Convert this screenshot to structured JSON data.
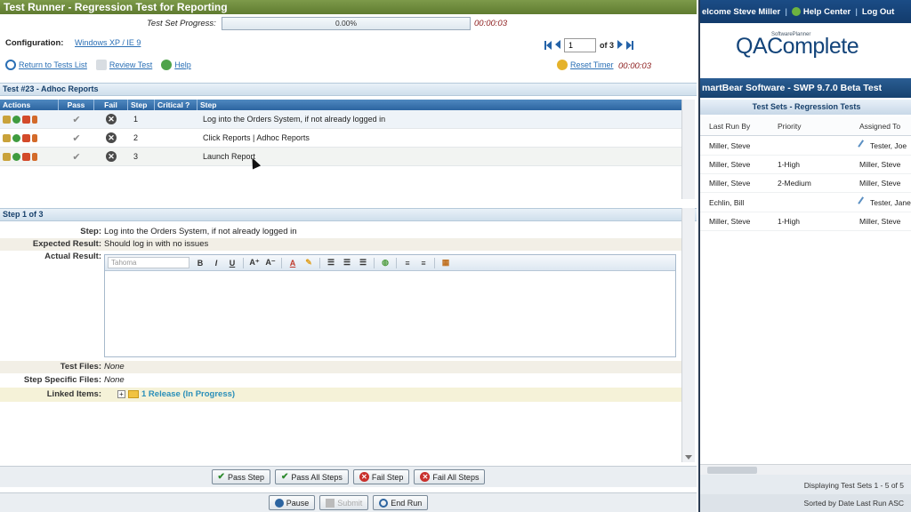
{
  "runner": {
    "title": "Test Runner - Regression Test for Reporting",
    "progress_label": "Test Set Progress:",
    "progress_value": "0.00%",
    "progress_time": "00:00:03",
    "config_label": "Configuration:",
    "config_value": "Windows XP / IE 9",
    "pager": {
      "current": "1",
      "of_label": "of 3"
    },
    "links": {
      "return": "Return to Tests List",
      "review": "Review Test",
      "help": "Help"
    },
    "reset_timer": "Reset Timer",
    "reset_time": "00:00:03",
    "test_header": "Test #23 - Adhoc Reports",
    "grid_headers": {
      "actions": "Actions",
      "pass": "Pass",
      "fail": "Fail",
      "step": "Step",
      "critical": "Critical ?",
      "step_text": "Step"
    },
    "steps": [
      {
        "no": "1",
        "text": "Log into the Orders System, if not already logged in"
      },
      {
        "no": "2",
        "text": "Click Reports | Adhoc Reports"
      },
      {
        "no": "3",
        "text": "Launch Report"
      }
    ],
    "step_header": "Step 1 of 3",
    "detail": {
      "step_label": "Step:",
      "step_value": "Log into the Orders System, if not already logged in",
      "expected_label": "Expected Result:",
      "expected_value": "Should log in with no issues",
      "actual_label": "Actual Result:",
      "font_select": "Tahoma",
      "test_files_label": "Test Files:",
      "test_files_value": "None",
      "step_files_label": "Step Specific Files:",
      "step_files_value": "None",
      "linked_label": "Linked Items:",
      "linked_value": "1 Release (In Progress)"
    },
    "buttons": {
      "pass_step": "Pass Step",
      "pass_all": "Pass All Steps",
      "fail_step": "Fail Step",
      "fail_all": "Fail All Steps",
      "pause": "Pause",
      "submit": "Submit",
      "end_run": "End Run"
    }
  },
  "qa": {
    "welcome": "elcome Steve Miller",
    "sep": "|",
    "help_center": "Help Center",
    "logout": "Log Out",
    "logo": "QAComplete",
    "logo_sub": "SoftwarePlanner",
    "banner": "martBear Software - SWP 9.7.0 Beta Test",
    "subheader": "Test Sets - Regression Tests",
    "headers": {
      "last_run_by": "Last Run By",
      "priority": "Priority",
      "assigned_to": "Assigned To"
    },
    "rows": [
      {
        "last_run_by": "Miller, Steve",
        "priority": "",
        "assigned_to": "Tester, Joe"
      },
      {
        "last_run_by": "Miller, Steve",
        "priority": "1-High",
        "assigned_to": "Miller, Steve"
      },
      {
        "last_run_by": "Miller, Steve",
        "priority": "2-Medium",
        "assigned_to": "Miller, Steve"
      },
      {
        "last_run_by": "Echlin, Bill",
        "priority": "",
        "assigned_to": "Tester, Jane"
      },
      {
        "last_run_by": "Miller, Steve",
        "priority": "1-High",
        "assigned_to": "Miller, Steve"
      }
    ],
    "footer_display": "Displaying Test Sets 1 - 5 of 5",
    "footer_sort": "Sorted by Date Last Run ASC"
  },
  "colors": {
    "title_green": "#6b8a3c",
    "accent_blue": "#2c64a0",
    "timer_red": "#8b1a1a"
  }
}
